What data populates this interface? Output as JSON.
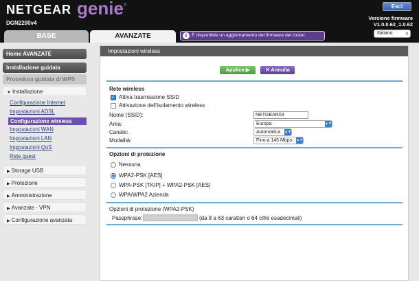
{
  "header": {
    "brand": "NETGEAR",
    "product": "genie",
    "trademark": "®",
    "model": "DGN2200v4",
    "logout_label": "Esci",
    "firmware_label": "Versione firmware",
    "firmware_version": "V1.0.0.62_1.0.62",
    "language": "Italiano",
    "update_banner": "È disponibile un aggiornamento del firmware del router."
  },
  "tabs": {
    "base": "BASE",
    "advanced": "AVANZATE"
  },
  "sidebar": {
    "home": "Home AVANZATE",
    "setup_wizard": "Installazione guidata",
    "wps": "Procedura guidata di WPS",
    "setup": "Installazione",
    "setup_items": [
      "Configurazione Internet",
      "Impostazioni ADSL",
      "Configurazione wireless",
      "Impostazioni WAN",
      "Impostazioni LAN",
      "Impostazioni QoS",
      "Rete guest"
    ],
    "sections": [
      "Storage USB",
      "Protezione",
      "Amministrazione",
      "Avanzate - VPN",
      "Configurazione avanzata"
    ]
  },
  "panel": {
    "title": "Impostazioni wireless",
    "apply_label": "Applica ▶",
    "cancel_label": "Annulla",
    "network_title": "Rete wireless",
    "ssid_broadcast": "Attiva trasmissione SSID",
    "isolation": "Attivazione dell'isolamento wireless",
    "ssid_label": "Nome (SSID):",
    "ssid_value": "NETGEAR03",
    "region_label": "Area:",
    "region_value": "Europa",
    "channel_label": "Canale:",
    "channel_value": "Automatica",
    "mode_label": "Modalità:",
    "mode_value": "Fino a 145 Mbps",
    "security_title": "Opzioni di protezione",
    "security_options": [
      "Nessuna",
      "WPA2-PSK [AES]",
      "WPA-PSK [TKIP] + WPA2-PSK [AES]",
      "WPA/WPA2 Azienda"
    ],
    "wpa2_title": "Opzioni di protezione (WPA2-PSK)",
    "passphrase_label": "Passphrase:",
    "passphrase_hint": "(da 8 a 63 caratteri o 64 cifre esadecimali)"
  }
}
